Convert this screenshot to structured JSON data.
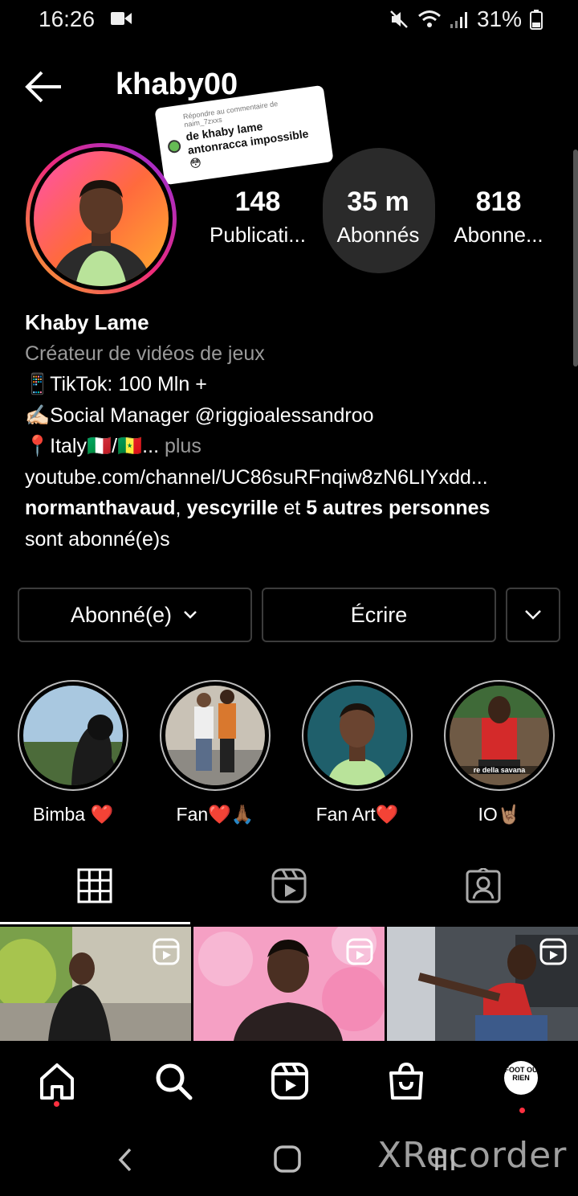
{
  "status_bar": {
    "time": "16:26",
    "battery": "31%"
  },
  "header": {
    "username": "khaby00"
  },
  "sticker": {
    "reply_to": "Répondre au commentaire de naim_7zxxs",
    "comment": "de khaby lame antonracca impossible 😳"
  },
  "stats": [
    {
      "value": "148",
      "label": "Publicati..."
    },
    {
      "value": "35 m",
      "label": "Abonnés"
    },
    {
      "value": "818",
      "label": "Abonne..."
    }
  ],
  "bio": {
    "name": "Khaby Lame",
    "category": "Créateur de vidéos de jeux",
    "line1": "📱TikTok: 100 Mln +",
    "line2": "✍🏻Social Manager @riggioalessandroo",
    "line3": "📍Italy🇮🇹/🇸🇳...",
    "more": " plus",
    "link": "youtube.com/channel/UC86suRFnqiw8zN6LIYxdd...",
    "followed_by_1": "normanthavaud",
    "followed_by_sep": ", ",
    "followed_by_2": "yescyrille",
    "followed_by_and": " et ",
    "followed_by_others": "5 autres personnes",
    "followed_by_suffix": "sont abonné(e)s"
  },
  "buttons": {
    "following": "Abonné(e)",
    "message": "Écrire"
  },
  "highlights": [
    {
      "label": "Bimba ❤️"
    },
    {
      "label": "Fan❤️🙏🏾"
    },
    {
      "label": "Fan Art❤️"
    },
    {
      "label": "IO🤘🏽",
      "caption": "re della savana"
    }
  ],
  "bottom_nav": {
    "profile_text": "FOOT OU RIEN"
  },
  "watermark": "XRecorder"
}
